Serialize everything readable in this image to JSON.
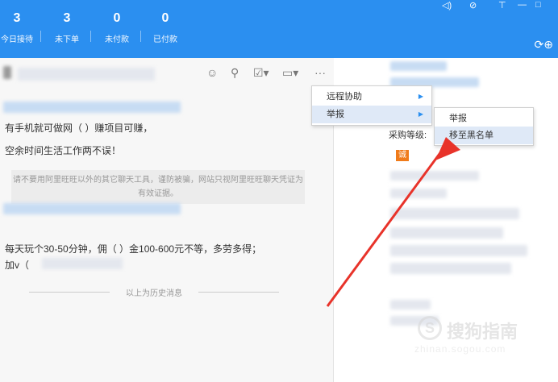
{
  "header": {
    "stats": [
      {
        "value": "3",
        "label": "今日接待"
      },
      {
        "value": "3",
        "label": "未下单"
      },
      {
        "value": "0",
        "label": "未付款"
      },
      {
        "value": "0",
        "label": "已付款"
      }
    ],
    "colors": {
      "header_bg": "#2b8ff0"
    }
  },
  "toolbar": {
    "icons": [
      "smiley-icon",
      "gift-icon",
      "edit-icon",
      "video-icon",
      "more-icon"
    ],
    "more_label": "···"
  },
  "chat": {
    "messages": [
      "有手机就可做网（ ）赚项目可赚，",
      "空余时间生活工作两不误！"
    ],
    "notice": "请不要用阿里旺旺以外的其它聊天工具，谨防被骗，网站只视阿里旺旺聊天凭证为有效证据。",
    "messages2": [
      "每天玩个30-50分钟，佣（ ）金100-600元不等，多劳多得；",
      "加v（"
    ],
    "history_label": "以上为历史消息"
  },
  "right_panel": {
    "level_label": "采购等级:",
    "badge": "诚"
  },
  "menu": {
    "items": [
      {
        "label": "远程协助",
        "has_submenu": true
      },
      {
        "label": "举报",
        "has_submenu": true
      }
    ],
    "submenu": [
      {
        "label": "举报"
      },
      {
        "label": "移至黑名单"
      }
    ]
  },
  "watermark": {
    "logo_char": "S",
    "main": "搜狗指南",
    "sub": "zhinan.sogou.com"
  },
  "annotation": {
    "arrow_color": "#e8332a"
  }
}
